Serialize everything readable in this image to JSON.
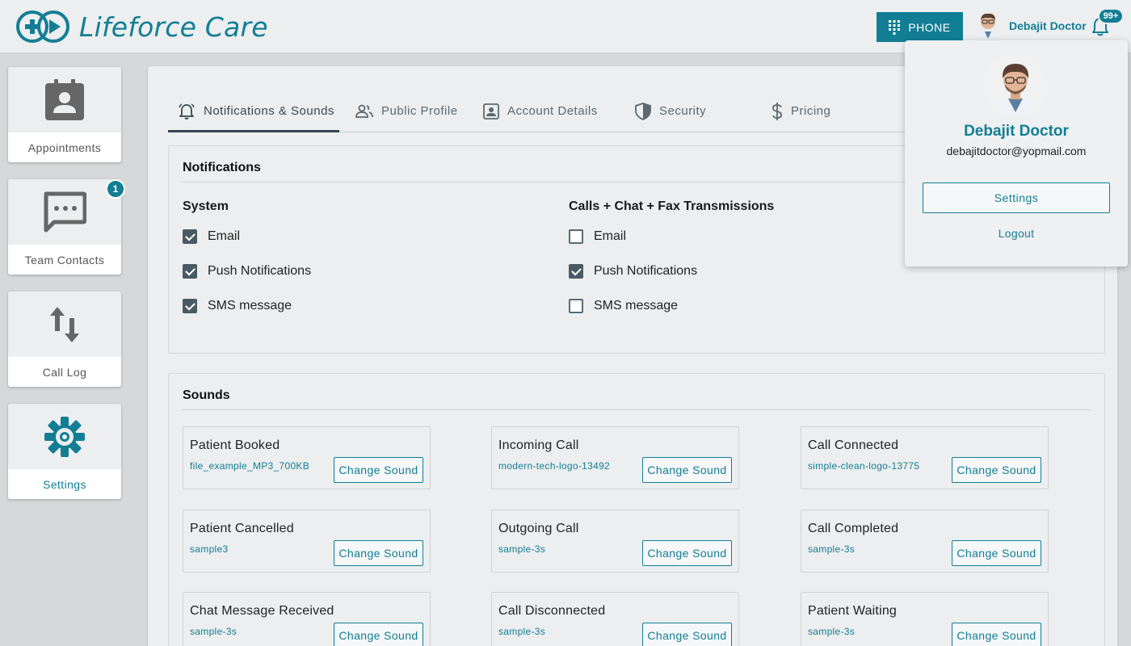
{
  "app": {
    "name": "Lifeforce Care"
  },
  "header": {
    "phone_label": "PHONE",
    "user_name": "Debajit Doctor",
    "notification_count": "99+"
  },
  "sidebar": {
    "items": [
      {
        "label": "Appointments",
        "icon": "calendar-contact-icon"
      },
      {
        "label": "Team Contacts",
        "icon": "chat-bubble-icon",
        "badge": "1"
      },
      {
        "label": "Call Log",
        "icon": "swap-vertical-icon"
      },
      {
        "label": "Settings",
        "icon": "gear-icon",
        "active": true
      }
    ]
  },
  "tabs": [
    {
      "label": "Notifications & Sounds",
      "icon": "bell-icon",
      "active": true
    },
    {
      "label": "Public Profile",
      "icon": "people-icon"
    },
    {
      "label": "Account Details",
      "icon": "id-card-icon"
    },
    {
      "label": "Security",
      "icon": "shield-icon"
    },
    {
      "label": "Pricing",
      "icon": "dollar-icon"
    }
  ],
  "notifications": {
    "title": "Notifications",
    "system": {
      "title": "System",
      "options": [
        {
          "label": "Email",
          "checked": true
        },
        {
          "label": "Push Notifications",
          "checked": true
        },
        {
          "label": "SMS message",
          "checked": true
        }
      ]
    },
    "calls": {
      "title": "Calls + Chat + Fax Transmissions",
      "options": [
        {
          "label": "Email",
          "checked": false
        },
        {
          "label": "Push Notifications",
          "checked": true
        },
        {
          "label": "SMS message",
          "checked": false
        }
      ]
    }
  },
  "sounds": {
    "title": "Sounds",
    "button_label": "Change Sound",
    "items": [
      {
        "name": "Patient Booked",
        "file": "file_example_MP3_700KB"
      },
      {
        "name": "Incoming Call",
        "file": "modern-tech-logo-13492"
      },
      {
        "name": "Call Connected",
        "file": "simple-clean-logo-13775"
      },
      {
        "name": "Patient Cancelled",
        "file": "sample3"
      },
      {
        "name": "Outgoing Call",
        "file": "sample-3s"
      },
      {
        "name": "Call Completed",
        "file": "sample-3s"
      },
      {
        "name": "Chat Message Received",
        "file": "sample-3s"
      },
      {
        "name": "Call Disconnected",
        "file": "sample-3s"
      },
      {
        "name": "Patient Waiting",
        "file": "sample-3s"
      }
    ]
  },
  "user_menu": {
    "name": "Debajit Doctor",
    "email": "debajitdoctor@yopmail.com",
    "settings_label": "Settings",
    "logout_label": "Logout"
  },
  "colors": {
    "brand": "#127e94",
    "dark": "#37474f",
    "background": "#eceeef"
  }
}
